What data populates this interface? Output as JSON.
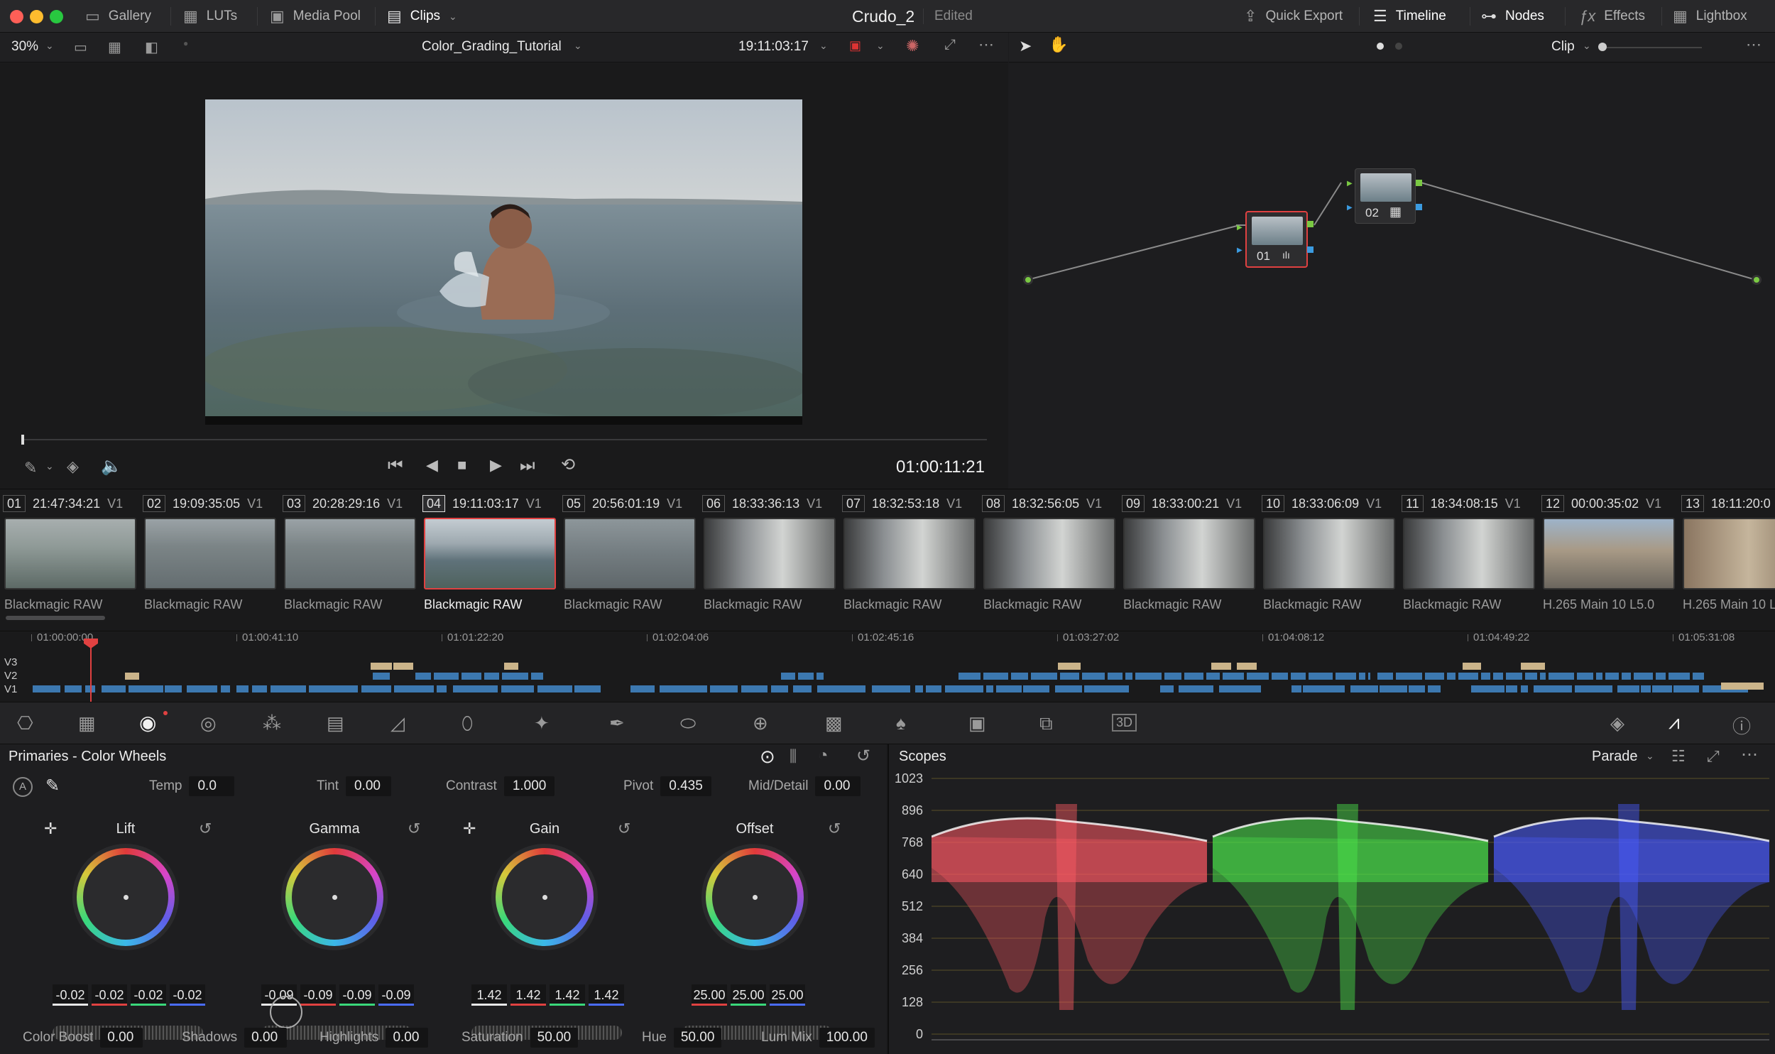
{
  "app": {
    "title": "Crudo_2",
    "status": "Edited",
    "left_tabs": [
      {
        "label": "Gallery",
        "icon": "gallery-icon"
      },
      {
        "label": "LUTs",
        "icon": "luts-icon"
      },
      {
        "label": "Media Pool",
        "icon": "media-pool-icon"
      },
      {
        "label": "Clips",
        "icon": "clips-icon"
      }
    ],
    "right_tabs": [
      {
        "label": "Quick Export",
        "icon": "export-icon"
      },
      {
        "label": "Timeline",
        "icon": "timeline-icon"
      },
      {
        "label": "Nodes",
        "icon": "nodes-icon"
      },
      {
        "label": "Effects",
        "icon": "fx-icon"
      },
      {
        "label": "Lightbox",
        "icon": "lightbox-icon"
      }
    ]
  },
  "viewer": {
    "zoom": "30%",
    "timeline_name": "Color_Grading_Tutorial",
    "source_timecode": "19:11:03:17",
    "record_timecode": "01:00:11:21"
  },
  "nodes": {
    "mode": "Clip",
    "items": [
      {
        "label": "01"
      },
      {
        "label": "02"
      }
    ]
  },
  "clips": [
    {
      "num": "01",
      "tc": "21:47:34:21",
      "track": "V1",
      "name": "Blackmagic RAW",
      "tone": "sea"
    },
    {
      "num": "02",
      "tc": "19:09:35:05",
      "track": "V1",
      "name": "Blackmagic RAW",
      "tone": "sea2"
    },
    {
      "num": "03",
      "tc": "20:28:29:16",
      "track": "V1",
      "name": "Blackmagic RAW",
      "tone": "sea2"
    },
    {
      "num": "04",
      "tc": "19:11:03:17",
      "track": "V1",
      "name": "Blackmagic RAW",
      "tone": "swim",
      "selected": true
    },
    {
      "num": "05",
      "tc": "20:56:01:19",
      "track": "V1",
      "name": "Blackmagic RAW",
      "tone": "sea3"
    },
    {
      "num": "06",
      "tc": "18:33:36:13",
      "track": "V1",
      "name": "Blackmagic RAW",
      "tone": "car"
    },
    {
      "num": "07",
      "tc": "18:32:53:18",
      "track": "V1",
      "name": "Blackmagic RAW",
      "tone": "car"
    },
    {
      "num": "08",
      "tc": "18:32:56:05",
      "track": "V1",
      "name": "Blackmagic RAW",
      "tone": "car"
    },
    {
      "num": "09",
      "tc": "18:33:00:21",
      "track": "V1",
      "name": "Blackmagic RAW",
      "tone": "car"
    },
    {
      "num": "10",
      "tc": "18:33:06:09",
      "track": "V1",
      "name": "Blackmagic RAW",
      "tone": "car"
    },
    {
      "num": "11",
      "tc": "18:34:08:15",
      "track": "V1",
      "name": "Blackmagic RAW",
      "tone": "car"
    },
    {
      "num": "12",
      "tc": "00:00:35:02",
      "track": "V1",
      "name": "H.265 Main 10 L5.0",
      "tone": "town"
    },
    {
      "num": "13",
      "tc": "18:11:20:0",
      "track": "",
      "name": "H.265 Main 10 L",
      "tone": "street"
    }
  ],
  "mini_timeline": {
    "ticks": [
      "01:00:00:00",
      "01:00:41:10",
      "01:01:22:20",
      "01:02:04:06",
      "01:02:45:16",
      "01:03:27:02",
      "01:04:08:12",
      "01:04:49:22",
      "01:05:31:08"
    ],
    "tracks": [
      "V3",
      "V2",
      "V1"
    ]
  },
  "primaries": {
    "title": "Primaries - Color Wheels",
    "top_fields": [
      {
        "label": "Temp",
        "value": "0.0"
      },
      {
        "label": "Tint",
        "value": "0.00"
      },
      {
        "label": "Contrast",
        "value": "1.000"
      },
      {
        "label": "Pivot",
        "value": "0.435"
      },
      {
        "label": "Mid/Detail",
        "value": "0.00"
      }
    ],
    "wheels": [
      {
        "name": "Lift",
        "values": [
          "-0.02",
          "-0.02",
          "-0.02",
          "-0.02"
        ]
      },
      {
        "name": "Gamma",
        "values": [
          "-0.09",
          "-0.09",
          "-0.09",
          "-0.09"
        ]
      },
      {
        "name": "Gain",
        "values": [
          "1.42",
          "1.42",
          "1.42",
          "1.42"
        ]
      },
      {
        "name": "Offset",
        "values": [
          "25.00",
          "25.00",
          "25.00"
        ]
      }
    ],
    "bottom_fields": [
      {
        "label": "Color Boost",
        "value": "0.00"
      },
      {
        "label": "Shadows",
        "value": "0.00"
      },
      {
        "label": "Highlights",
        "value": "0.00"
      },
      {
        "label": "Saturation",
        "value": "50.00"
      },
      {
        "label": "Hue",
        "value": "50.00"
      },
      {
        "label": "Lum Mix",
        "value": "100.00"
      }
    ]
  },
  "scopes": {
    "title": "Scopes",
    "mode": "Parade",
    "y_labels": [
      "1023",
      "896",
      "768",
      "640",
      "512",
      "384",
      "256",
      "128",
      "0"
    ]
  },
  "colors": {
    "accent_red": "#e04141",
    "node_green": "#7ac943",
    "node_blue": "#3b9be0",
    "parade_red": "#ff5a64",
    "parade_green": "#4ce84c",
    "parade_blue": "#4a5cff"
  }
}
